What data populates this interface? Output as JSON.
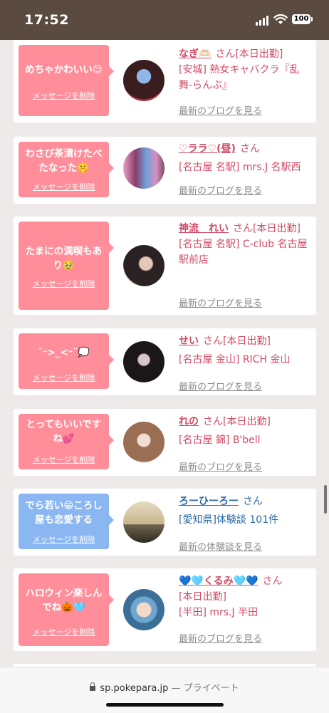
{
  "status": {
    "time": "17:52",
    "battery": "100"
  },
  "delete_label": "メッセージを削除",
  "san": "さん",
  "items": [
    {
      "message": "めちゃかわいい😌",
      "name": "なぎ🫶🏻",
      "after_name": "[本日出勤]",
      "shop": "[安城] 熟女キャバクラ『乱舞-らんぶ』",
      "blog": "最新のブログを見る"
    },
    {
      "message": "わさび茶漬けたべたなった🤫",
      "name": "♡ララ♡(昼)",
      "after_name": "",
      "shop": "[名古屋 名駅] mrs.J 名駅西",
      "blog": "最新のブログを見る"
    },
    {
      "message": "たまにの満喫もあり🥹",
      "name": "神流　れい",
      "after_name": "[本日出勤]",
      "shop": "[名古屋 名駅] C-club 名古屋駅前店",
      "blog": "最新のブログを見る"
    },
    {
      "message": "˘ᵕ>_<ᵕ˘💭",
      "name": "せい",
      "after_name": "[本日出勤]",
      "shop": "[名古屋 金山] RICH 金山",
      "blog": "最新のブログを見る"
    },
    {
      "message": "とってもいいですね💕",
      "name": "れの",
      "after_name": "[本日出勤]",
      "shop": "[名古屋 錦] B'bell",
      "blog": "最新のブログを見る"
    },
    {
      "message": "でら若い😁ころし屋も恋愛する",
      "name": "ろーひーろー",
      "after_name": "",
      "shop": "[愛知県]体験談 101件",
      "blog": "最新の体験談を見る"
    },
    {
      "message": "ハロウィン楽しんでね🎃🩵",
      "name": "💙🩵くるみ🩵💙",
      "after_name": "",
      "shop_line1": "[本日出勤]",
      "shop": "[半田] mrs.J 半田",
      "blog": "最新のブログを見る"
    }
  ],
  "browser": {
    "url": "sp.pokepara.jp",
    "privacy": "— プライベート"
  },
  "colors": {
    "status_bar": "#5b4a3f",
    "pink": "#ff8e9a",
    "blue": "#8ab7f2",
    "name_pink": "#d24a64",
    "name_blue": "#2b6aa8"
  }
}
